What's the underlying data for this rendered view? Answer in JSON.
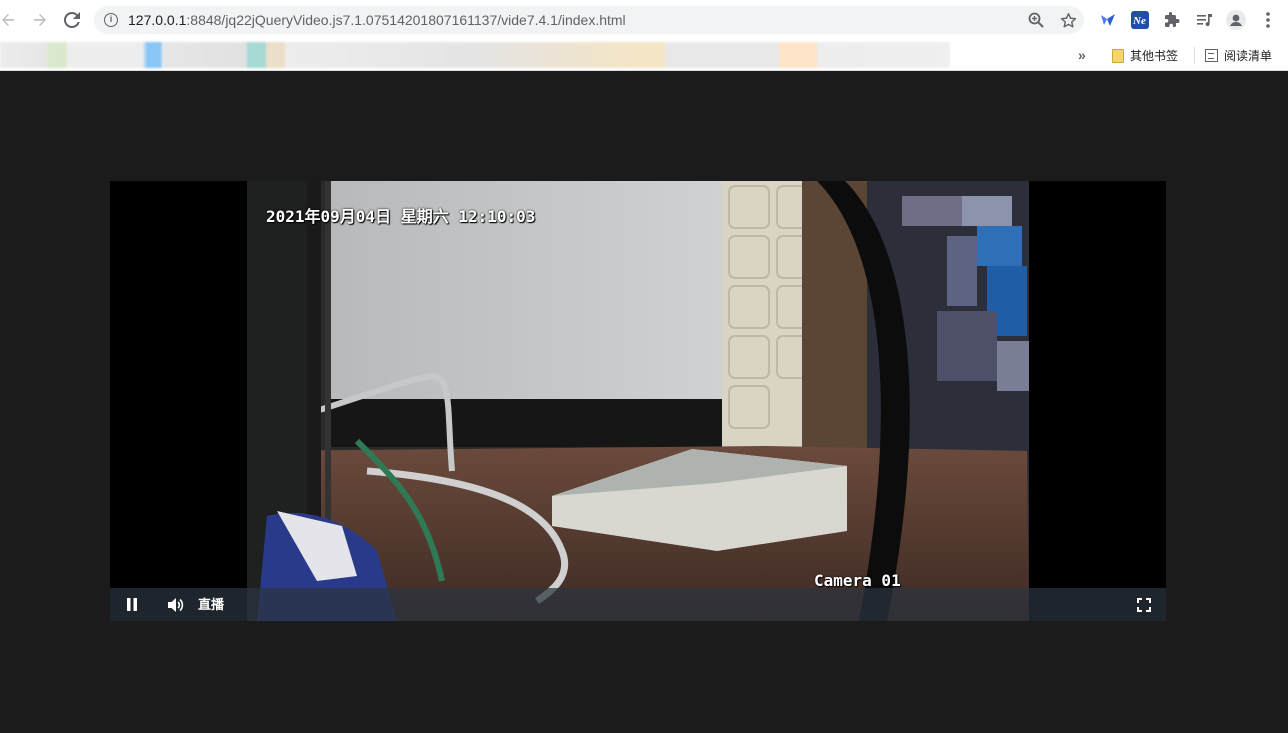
{
  "browser": {
    "url_host": "127.0.0.1",
    "url_rest": ":8848/jq22jQueryVideo.js7.1.07514201807161137/vide7.4.1/index.html",
    "bookmarks": {
      "overflow_label": "»",
      "other_bookmarks": "其他书签",
      "reading_list": "阅读清单"
    },
    "icons": [
      "back-icon",
      "forward-icon",
      "reload-icon",
      "info-icon",
      "zoom-icon",
      "star-icon",
      "extension-1-icon",
      "extension-2-icon",
      "puzzle-icon",
      "media-icon",
      "profile-icon",
      "menu-icon"
    ]
  },
  "player": {
    "osd_datetime": "2021年09月04日  星期六  12:10:03",
    "osd_camera": "Camera 01",
    "controls": {
      "play_state": "pause-icon",
      "volume": "volume-icon",
      "live_label": "直播",
      "fullscreen": "fullscreen-icon"
    },
    "colors": {
      "page_background": "#1b1b1b",
      "control_bar": "#2b333f"
    }
  }
}
